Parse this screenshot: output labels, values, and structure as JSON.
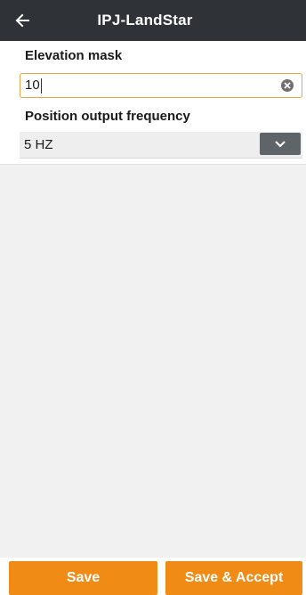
{
  "app": {
    "title": "IPJ-LandStar",
    "back_icon": "arrow-left-icon"
  },
  "form": {
    "elevation_mask": {
      "label": "Elevation mask",
      "value": "10",
      "clear_icon": "clear-circle-icon"
    },
    "position_output_frequency": {
      "label": "Position output frequency",
      "selected": "5 HZ",
      "dropdown_icon": "chevron-down-icon"
    }
  },
  "actions": {
    "save_label": "Save",
    "save_accept_label": "Save & Accept"
  },
  "colors": {
    "appbar": "#2f3337",
    "accent": "#f08b16",
    "input_border": "#f0a349",
    "dropdown_button": "#5f6468"
  }
}
